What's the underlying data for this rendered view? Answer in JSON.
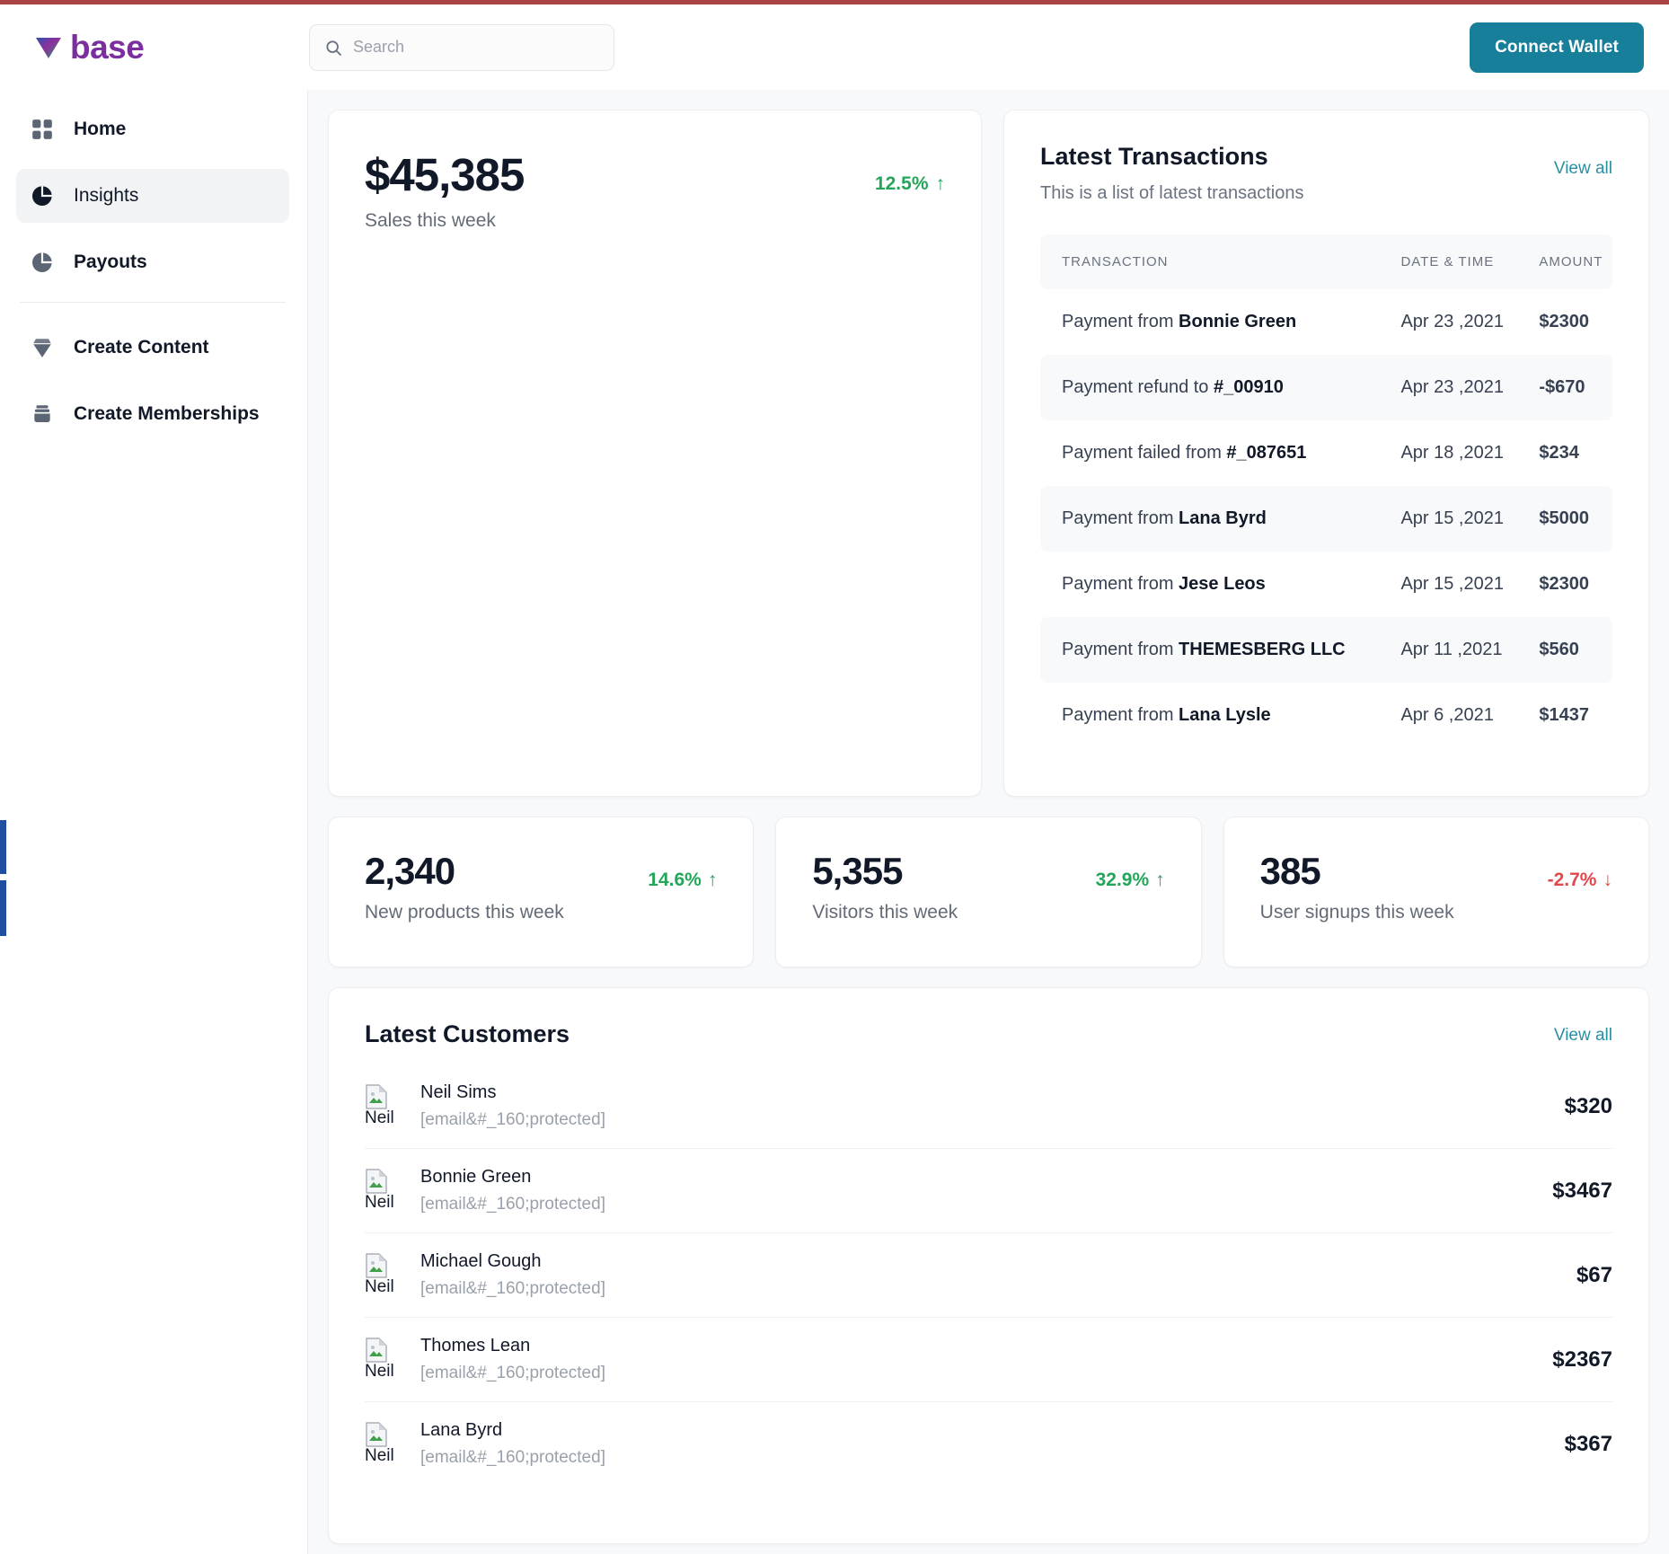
{
  "brand": {
    "name": "base"
  },
  "search": {
    "value": "",
    "placeholder": "Search"
  },
  "header": {
    "connect_label": "Connect Wallet"
  },
  "sidebar": {
    "items": [
      {
        "label": "Home",
        "icon": "grid-icon",
        "active": false
      },
      {
        "label": "Insights",
        "icon": "pie-chart-icon",
        "active": true
      },
      {
        "label": "Payouts",
        "icon": "pie-chart-icon",
        "active": false
      },
      {
        "label": "Create Content",
        "icon": "gem-icon",
        "active": false
      },
      {
        "label": "Create Memberships",
        "icon": "briefcase-icon",
        "active": false
      }
    ]
  },
  "sales": {
    "figure": "$45,385",
    "subtitle": "Sales this week",
    "delta": "12.5%",
    "delta_arrow": "↑",
    "delta_color": "#23a55a"
  },
  "transactions": {
    "title": "Latest Transactions",
    "description": "This is a list of latest transactions",
    "view_all": "View all",
    "columns": [
      "TRANSACTION",
      "DATE & TIME",
      "AMOUNT"
    ],
    "rows": [
      {
        "prefix": "Payment from ",
        "entity": "Bonnie Green",
        "date": "Apr 23 ,2021",
        "amount": "$2300"
      },
      {
        "prefix": "Payment refund to ",
        "entity": "#_00910",
        "date": "Apr 23 ,2021",
        "amount": "-$670"
      },
      {
        "prefix": "Payment failed from ",
        "entity": "#_087651",
        "date": "Apr 18 ,2021",
        "amount": "$234"
      },
      {
        "prefix": "Payment from ",
        "entity": "Lana Byrd",
        "date": "Apr 15 ,2021",
        "amount": "$5000"
      },
      {
        "prefix": "Payment from ",
        "entity": "Jese Leos",
        "date": "Apr 15 ,2021",
        "amount": "$2300"
      },
      {
        "prefix": "Payment from ",
        "entity": "THEMESBERG LLC",
        "date": "Apr 11 ,2021",
        "amount": "$560"
      },
      {
        "prefix": "Payment from ",
        "entity": "Lana Lysle",
        "date": "Apr 6 ,2021",
        "amount": "$1437"
      }
    ]
  },
  "stats": [
    {
      "figure": "2,340",
      "label": "New products this week",
      "delta": "14.6%",
      "arrow": "↑",
      "direction": "up"
    },
    {
      "figure": "5,355",
      "label": "Visitors this week",
      "delta": "32.9%",
      "arrow": "↑",
      "direction": "up"
    },
    {
      "figure": "385",
      "label": "User signups this week",
      "delta": "-2.7%",
      "arrow": "↓",
      "direction": "down"
    }
  ],
  "customers": {
    "title": "Latest Customers",
    "view_all": "View all",
    "avatar_alt": "Neil",
    "rows": [
      {
        "name": "Neil Sims",
        "email": "[email&#_160;protected]",
        "amount": "$320"
      },
      {
        "name": "Bonnie Green",
        "email": "[email&#_160;protected]",
        "amount": "$3467"
      },
      {
        "name": "Michael Gough",
        "email": "[email&#_160;protected]",
        "amount": "$67"
      },
      {
        "name": "Thomes Lean",
        "email": "[email&#_160;protected]",
        "amount": "$2367"
      },
      {
        "name": "Lana Byrd",
        "email": "[email&#_160;protected]",
        "amount": "$367"
      }
    ]
  },
  "colors": {
    "accent_teal": "#177f99",
    "link_teal": "#2a8fa2",
    "positive": "#23a55a",
    "negative": "#e0484c",
    "brand_purple": "#7b2f9e"
  }
}
